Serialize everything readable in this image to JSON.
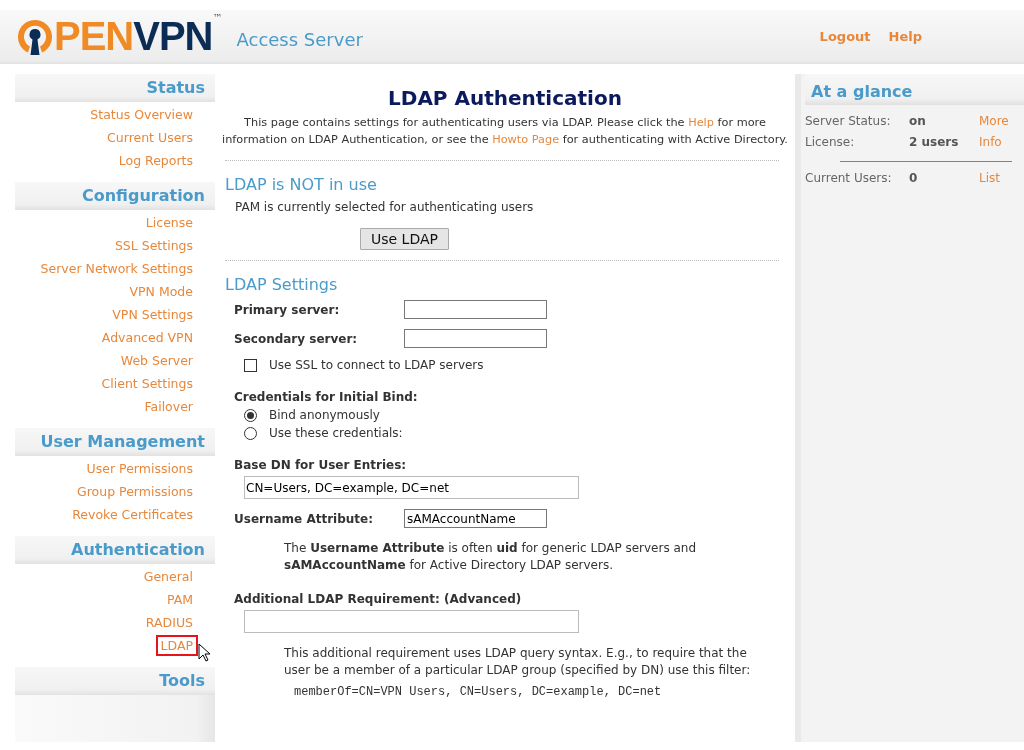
{
  "header": {
    "logo": {
      "first": "PEN",
      "second": "VPN",
      "mark": "™"
    },
    "product": "Access Server",
    "links": [
      "Logout",
      "Help"
    ]
  },
  "sidebar": {
    "sections": [
      {
        "title": "Status",
        "items": [
          {
            "label": "Status Overview",
            "selected": false
          },
          {
            "label": "Current Users",
            "selected": false
          },
          {
            "label": "Log Reports",
            "selected": false
          }
        ]
      },
      {
        "title": "Configuration",
        "items": [
          {
            "label": "License",
            "selected": false
          },
          {
            "label": "SSL Settings",
            "selected": false
          },
          {
            "label": "Server Network Settings",
            "selected": false
          },
          {
            "label": "VPN Mode",
            "selected": false
          },
          {
            "label": "VPN Settings",
            "selected": false
          },
          {
            "label": "Advanced VPN",
            "selected": false
          },
          {
            "label": "Web Server",
            "selected": false
          },
          {
            "label": "Client Settings",
            "selected": false
          },
          {
            "label": "Failover",
            "selected": false
          }
        ]
      },
      {
        "title": "User Management",
        "items": [
          {
            "label": "User Permissions",
            "selected": false
          },
          {
            "label": "Group Permissions",
            "selected": false
          },
          {
            "label": "Revoke Certificates",
            "selected": false
          }
        ]
      },
      {
        "title": "Authentication",
        "items": [
          {
            "label": "General",
            "selected": false
          },
          {
            "label": "PAM",
            "selected": false
          },
          {
            "label": "RADIUS",
            "selected": false
          },
          {
            "label": "LDAP",
            "selected": true
          }
        ]
      },
      {
        "title": "Tools"
      }
    ]
  },
  "main": {
    "title": "LDAP Authentication",
    "intro": [
      {
        "kind": "text",
        "text": "This page contains settings for authenticating users via LDAP. Please click the "
      },
      {
        "kind": "link",
        "text": "Help"
      },
      {
        "kind": "text",
        "text": " for more information on LDAP Authentication, or see the "
      },
      {
        "kind": "link",
        "text": "Howto Page"
      },
      {
        "kind": "text",
        "text": " for authenticating with Active Directory."
      }
    ],
    "status": {
      "heading": "LDAP is NOT in use",
      "text": "PAM is currently selected for authenticating users",
      "button": "Use LDAP"
    },
    "settings": {
      "heading": "LDAP Settings",
      "rows": [
        {
          "kind": "field",
          "label": "Primary server:",
          "value": ""
        },
        {
          "kind": "field",
          "label": "Secondary server:",
          "value": ""
        },
        {
          "kind": "checkbox",
          "label": "Use SSL to connect to LDAP servers",
          "checked": false
        },
        {
          "kind": "label",
          "label": "Credentials for Initial Bind:"
        },
        {
          "kind": "radio",
          "label": "Bind anonymously",
          "selected": true
        },
        {
          "kind": "radio",
          "label": "Use these credentials:",
          "selected": false
        },
        {
          "kind": "label",
          "label": "Base DN for User Entries:"
        },
        {
          "kind": "wide",
          "value": "CN=Users, DC=example, DC=net"
        },
        {
          "kind": "field",
          "label": "Username Attribute:",
          "value": "sAMAccountName"
        },
        {
          "kind": "note",
          "text": "The **Username Attribute** is often **uid** for generic LDAP servers and **sAMAccountName** for Active Directory LDAP servers."
        },
        {
          "kind": "label",
          "label": "Additional LDAP Requirement: (Advanced)"
        },
        {
          "kind": "wide",
          "value": ""
        },
        {
          "kind": "note",
          "text": "This additional requirement uses LDAP query syntax. E.g., to require that the user be a member of a particular LDAP group (specified by DN) use this filter:"
        },
        {
          "kind": "code",
          "text": "memberOf=CN=VPN Users, CN=Users, DC=example, DC=net"
        }
      ]
    }
  },
  "glance": {
    "title": "At a glance",
    "groups": [
      [
        {
          "label": "Server Status:",
          "value": "on",
          "link": "More"
        },
        {
          "label": "License:",
          "value": "2 users",
          "link": "Info"
        }
      ],
      [
        {
          "label": "Current Users:",
          "value": "0",
          "link": "List"
        }
      ]
    ]
  }
}
